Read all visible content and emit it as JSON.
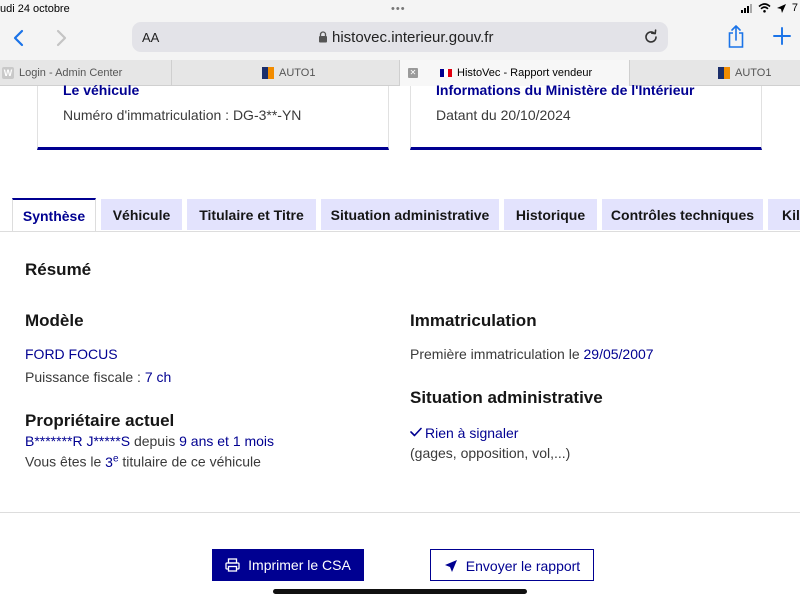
{
  "status_bar": {
    "date": "udi 24 octobre",
    "battery": "7"
  },
  "browser": {
    "reader_label": "AA",
    "url": "histovec.interieur.gouv.fr",
    "tabs": [
      {
        "label": "Login - Admin Center",
        "icon": "w-favicon"
      },
      {
        "label": "AUTO1",
        "icon": "auto1-favicon"
      },
      {
        "label": "HistoVec - Rapport vendeur",
        "icon": "french-flag-favicon",
        "active": true
      },
      {
        "label": "AUTO1",
        "icon": "auto1-favicon"
      }
    ]
  },
  "cards": {
    "vehicle": {
      "title": "Le véhicule",
      "text": "Numéro d'immatriculation : DG-3**-YN"
    },
    "ministere": {
      "title": "Informations du Ministère de l'Intérieur",
      "text": "Datant du 20/10/2024"
    }
  },
  "section_tabs": [
    "Synthèse",
    "Véhicule",
    "Titulaire et Titre",
    "Situation administrative",
    "Historique",
    "Contrôles techniques",
    "Kil"
  ],
  "summary": {
    "title": "Résumé",
    "modele": {
      "heading": "Modèle",
      "model": "FORD FOCUS",
      "puissance_label": "Puissance fiscale :",
      "puissance_value": "7 ch"
    },
    "proprietaire": {
      "heading": "Propriétaire actuel",
      "name": "B*******R J*****S",
      "depuis_label": "depuis",
      "depuis_value": "9 ans et 1 mois",
      "titulaire_prefix": "Vous êtes le",
      "titulaire_rank": "3",
      "titulaire_sup": "e",
      "titulaire_suffix": "titulaire de ce véhicule"
    },
    "immatriculation": {
      "heading": "Immatriculation",
      "label": "Première immatriculation le",
      "date": "29/05/2007"
    },
    "situation": {
      "heading": "Situation administrative",
      "status": "Rien à signaler",
      "details": "(gages, opposition, vol,...)"
    }
  },
  "actions": {
    "print": "Imprimer le CSA",
    "send": "Envoyer le rapport"
  },
  "colors": {
    "primary": "#000091",
    "tab_bg": "#e3e3fd"
  }
}
